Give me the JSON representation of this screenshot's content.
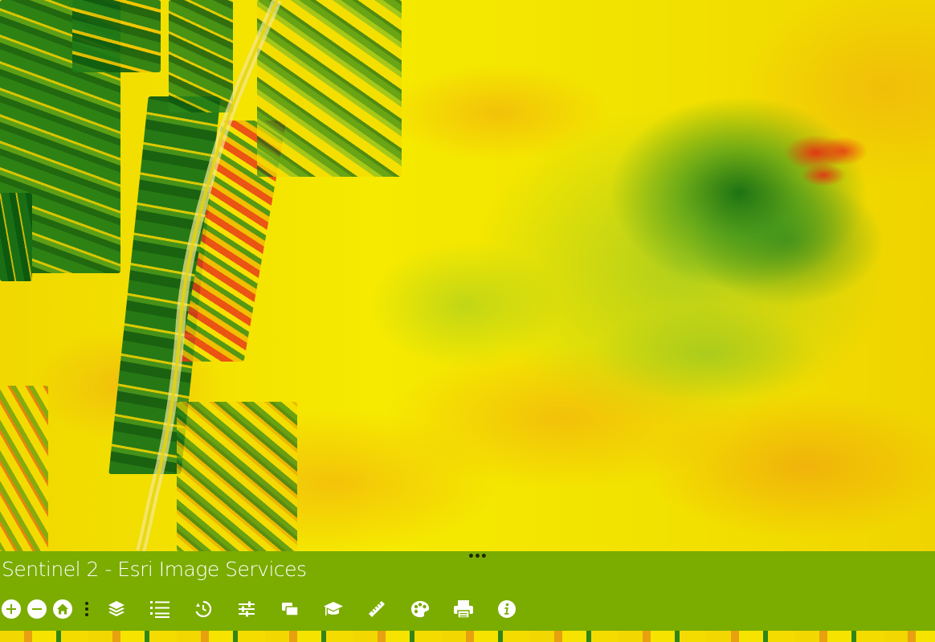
{
  "app": {
    "title": "Sentinel 2 - Esri Image Services"
  },
  "colors": {
    "panel": "#7bac00",
    "ndvi_high": "#0f6a12",
    "ndvi_mid": "#f4e400",
    "ndvi_low": "#e8301a",
    "icon": "#ffffff"
  },
  "map": {
    "visualization": "NDVI colorized imagery"
  },
  "toolbar": {
    "zoom_in_icon": "plus-icon",
    "zoom_out_icon": "minus-icon",
    "home_icon": "home-icon",
    "more_icon": "vertical-ellipsis-icon",
    "tools": [
      {
        "name": "layers-icon"
      },
      {
        "name": "legend-list-icon"
      },
      {
        "name": "time-history-icon"
      },
      {
        "name": "renderer-sliders-icon"
      },
      {
        "name": "compare-layers-icon"
      },
      {
        "name": "education-cap-icon"
      },
      {
        "name": "measure-ruler-icon"
      },
      {
        "name": "classify-palette-icon"
      },
      {
        "name": "print-icon"
      },
      {
        "name": "info-icon"
      }
    ]
  }
}
